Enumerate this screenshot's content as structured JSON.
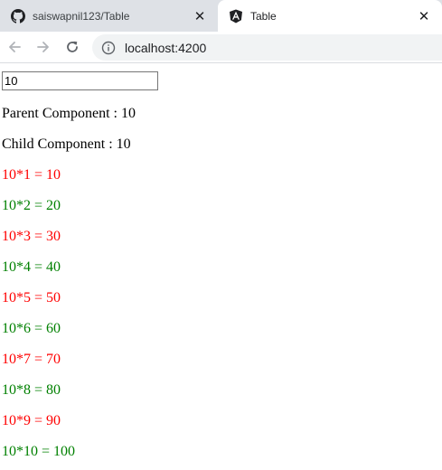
{
  "browser": {
    "tabs": [
      {
        "title": "saiswapnil123/Table",
        "icon": "github-icon",
        "active": false
      },
      {
        "title": "Table",
        "icon": "angular-icon",
        "active": true
      }
    ],
    "address": "localhost:4200"
  },
  "page": {
    "input_value": "10",
    "parent_label": "Parent Component : 10",
    "child_label": "Child Component : 10",
    "colors": {
      "odd": "#ff0000",
      "even": "#008000"
    },
    "table_rows": [
      "10*1 = 10",
      "10*2 = 20",
      "10*3 = 30",
      "10*4 = 40",
      "10*5 = 50",
      "10*6 = 60",
      "10*7 = 70",
      "10*8 = 80",
      "10*9 = 90",
      "10*10 = 100"
    ]
  }
}
